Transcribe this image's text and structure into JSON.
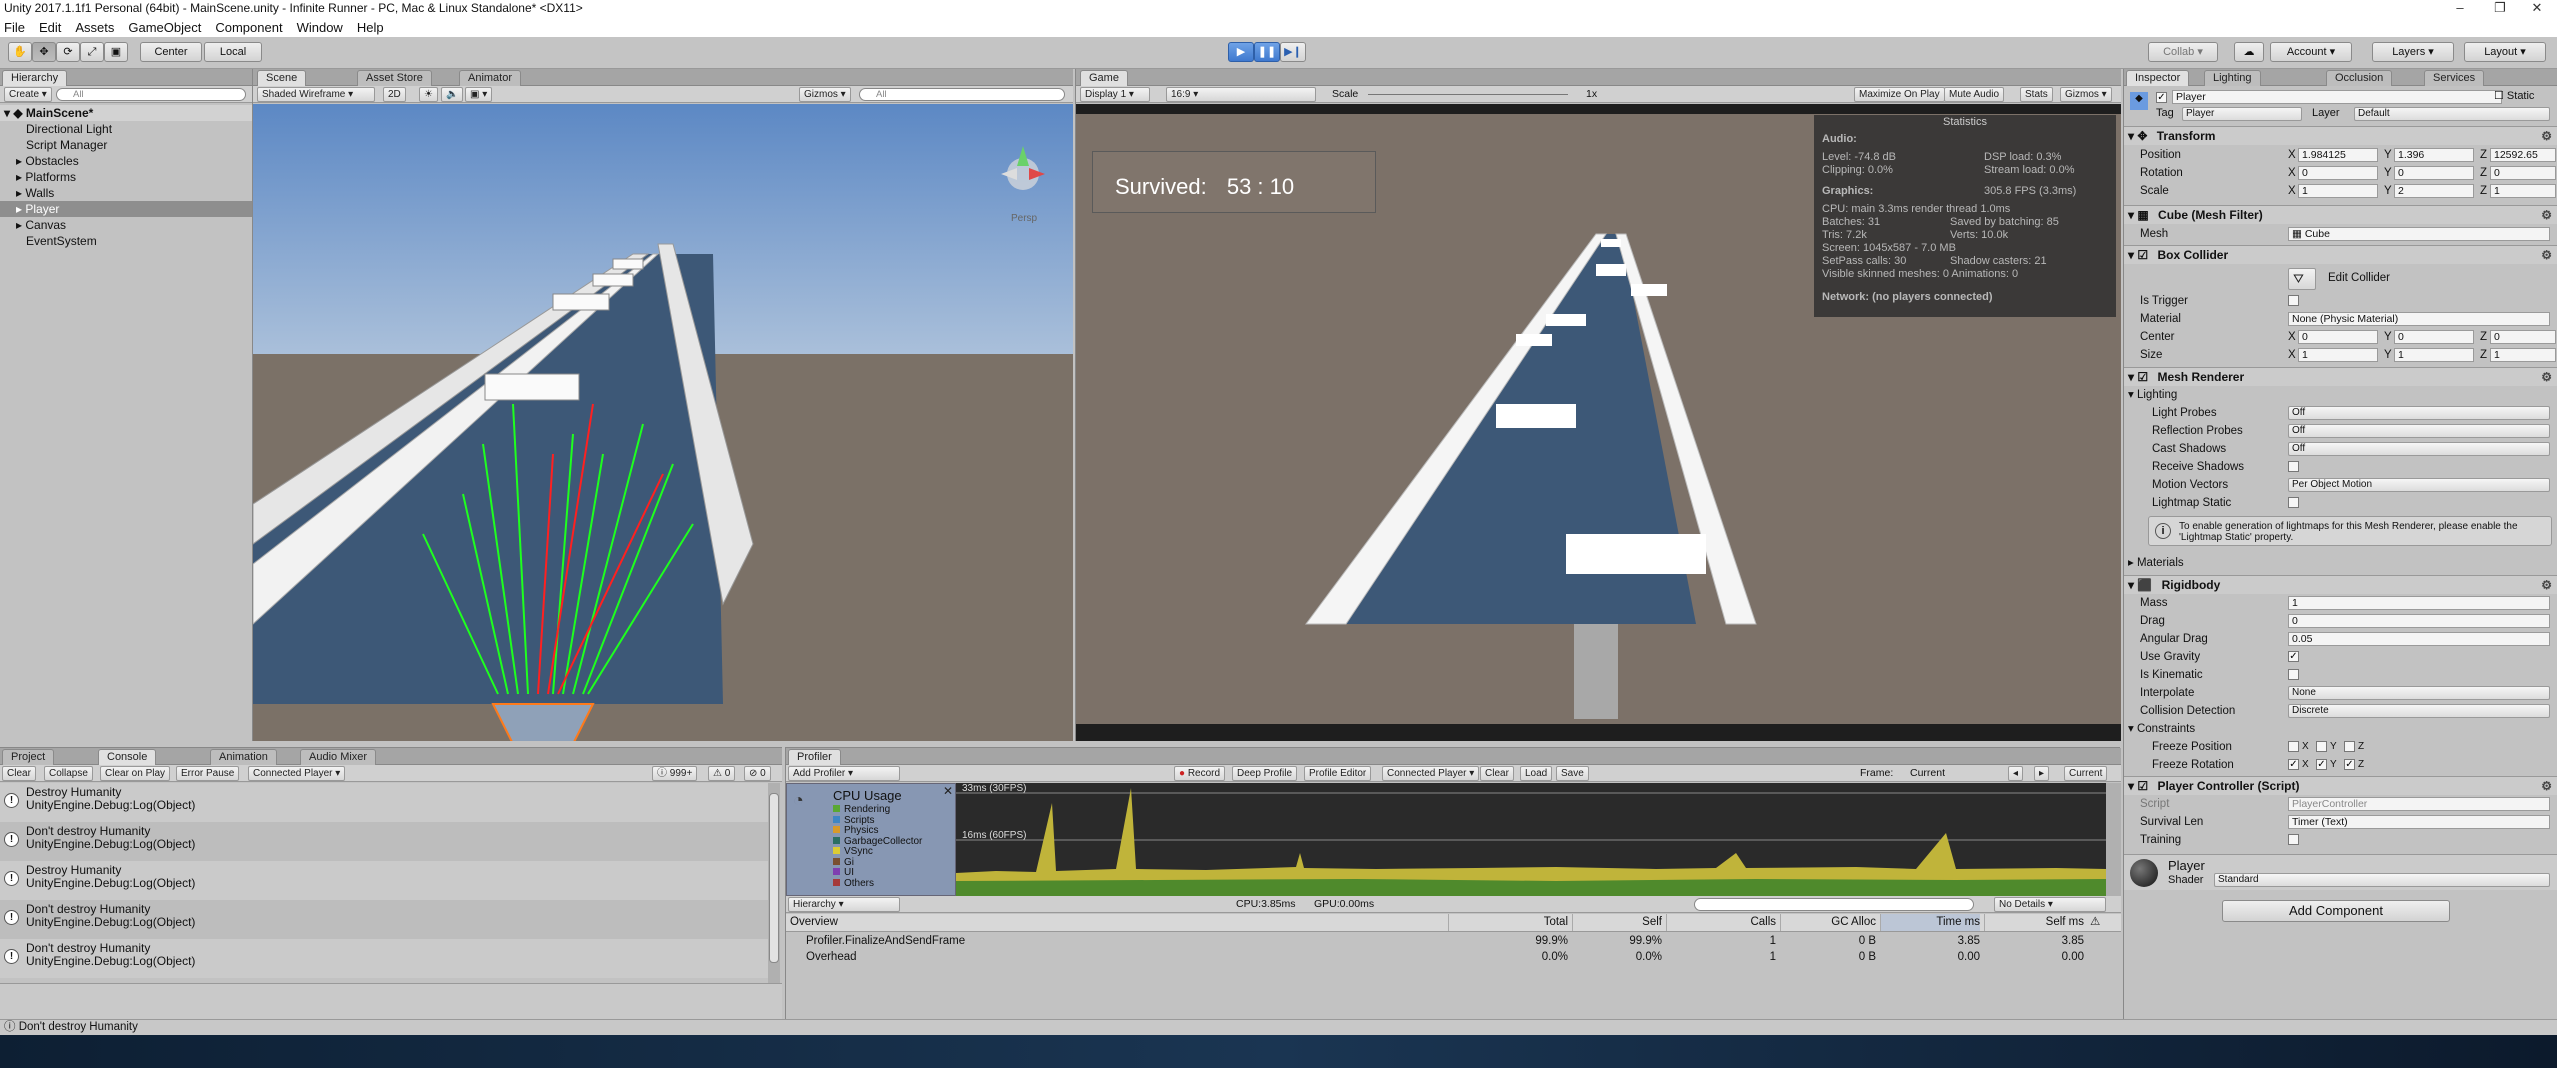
{
  "window": {
    "title": "Unity 2017.1.1f1 Personal (64bit) - MainScene.unity - Infinite Runner - PC, Mac & Linux Standalone* <DX11>"
  },
  "menu": [
    "File",
    "Edit",
    "Assets",
    "GameObject",
    "Component",
    "Window",
    "Help"
  ],
  "toolbar": {
    "center": "Center",
    "local": "Local",
    "collab": "Collab",
    "account": "Account",
    "layers": "Layers",
    "layout": "Layout"
  },
  "hierarchy": {
    "tab": "Hierarchy",
    "create": "Create",
    "search": "All",
    "scene": "MainScene*",
    "items": [
      "Directional Light",
      "Script Manager",
      "Obstacles",
      "Platforms",
      "Walls",
      "Player",
      "Canvas",
      "EventSystem"
    ]
  },
  "scene": {
    "tabs": [
      "Scene",
      "Asset Store",
      "Animator"
    ],
    "shading": "Shaded Wireframe",
    "mode2d": "2D",
    "gizmos": "Gizmos",
    "search": "All",
    "persp": "Persp"
  },
  "game": {
    "tab": "Game",
    "display": "Display 1",
    "aspect": "16:9",
    "scale_label": "Scale",
    "scale_value": "1x",
    "maximize": "Maximize On Play",
    "mute": "Mute Audio",
    "stats": "Stats",
    "gizmos": "Gizmos",
    "survived_label": "Survived:",
    "survived_value": "53 : 10"
  },
  "statistics": {
    "title": "Statistics",
    "audio_h": "Audio:",
    "level": "Level: -74.8 dB",
    "clipping": "Clipping: 0.0%",
    "dsp": "DSP load: 0.3%",
    "stream": "Stream load: 0.0%",
    "graphics_h": "Graphics:",
    "fps": "305.8 FPS (3.3ms)",
    "cpu": "CPU: main 3.3ms  render thread 1.0ms",
    "batches": "Batches: 31",
    "saved": "Saved by batching: 85",
    "tris": "Tris: 7.2k",
    "verts": "Verts: 10.0k",
    "screen": "Screen: 1045x587 - 7.0 MB",
    "setpass": "SetPass calls: 30",
    "shadow": "Shadow casters: 21",
    "skinned": "Visible skinned meshes: 0   Animations: 0",
    "network": "Network: (no players connected)"
  },
  "inspector": {
    "tabs": [
      "Inspector",
      "Lighting",
      "Occlusion",
      "Services"
    ],
    "name": "Player",
    "static": "Static",
    "tag_label": "Tag",
    "tag": "Player",
    "layer_label": "Layer",
    "layer": "Default",
    "transform": {
      "title": "Transform",
      "rows": [
        {
          "label": "Position",
          "x": "1.984125",
          "y": "1.396",
          "z": "12592.65"
        },
        {
          "label": "Rotation",
          "x": "0",
          "y": "0",
          "z": "0"
        },
        {
          "label": "Scale",
          "x": "1",
          "y": "2",
          "z": "1"
        }
      ]
    },
    "meshfilter": {
      "title": "Cube (Mesh Filter)",
      "mesh_label": "Mesh",
      "mesh": "Cube"
    },
    "boxcollider": {
      "title": "Box Collider",
      "edit": "Edit Collider",
      "is_trigger": "Is Trigger",
      "material_label": "Material",
      "material": "None (Physic Material)",
      "center_label": "Center",
      "cx": "0",
      "cy": "0",
      "cz": "0",
      "size_label": "Size",
      "sx": "1",
      "sy": "1",
      "sz": "1"
    },
    "meshrenderer": {
      "title": "Mesh Renderer",
      "lighting": "Lighting",
      "rows": [
        {
          "label": "Light Probes",
          "value": "Off"
        },
        {
          "label": "Reflection Probes",
          "value": "Off"
        },
        {
          "label": "Cast Shadows",
          "value": "Off"
        }
      ],
      "receive": "Receive Shadows",
      "motion_label": "Motion Vectors",
      "motion": "Per Object Motion",
      "lightmap": "Lightmap Static",
      "info": "To enable generation of lightmaps for this Mesh Renderer, please enable the 'Lightmap Static' property.",
      "materials": "Materials"
    },
    "rigidbody": {
      "title": "Rigidbody",
      "mass_label": "Mass",
      "mass": "1",
      "drag_label": "Drag",
      "drag": "0",
      "adrag_label": "Angular Drag",
      "adrag": "0.05",
      "gravity": "Use Gravity",
      "kinematic": "Is Kinematic",
      "interp_label": "Interpolate",
      "interp": "None",
      "coll_label": "Collision Detection",
      "coll": "Discrete",
      "constraints": "Constraints",
      "fpos": "Freeze Position",
      "frot": "Freeze Rotation",
      "x": "X",
      "y": "Y",
      "z": "Z"
    },
    "playercontroller": {
      "title": "Player Controller (Script)",
      "script_label": "Script",
      "script": "PlayerController",
      "surv_label": "Survival Len",
      "surv": "Timer (Text)",
      "training": "Training"
    },
    "material": {
      "name": "Player",
      "shader_label": "Shader",
      "shader": "Standard"
    },
    "add_component": "Add Component"
  },
  "console": {
    "tabs": [
      "Project",
      "Console",
      "Animation",
      "Audio Mixer"
    ],
    "buttons": [
      "Clear",
      "Collapse",
      "Clear on Play",
      "Error Pause",
      "Connected Player"
    ],
    "count_log": "999+",
    "count_warn": "0",
    "count_err": "0",
    "entries": [
      {
        "line1": "Destroy Humanity",
        "line2": "UnityEngine.Debug:Log(Object)"
      },
      {
        "line1": "Don't destroy Humanity",
        "line2": "UnityEngine.Debug:Log(Object)"
      },
      {
        "line1": "Destroy Humanity",
        "line2": "UnityEngine.Debug:Log(Object)"
      },
      {
        "line1": "Don't destroy Humanity",
        "line2": "UnityEngine.Debug:Log(Object)"
      },
      {
        "line1": "Don't destroy Humanity",
        "line2": "UnityEngine.Debug:Log(Object)"
      }
    ],
    "status": "Don't destroy Humanity"
  },
  "profiler": {
    "tab": "Profiler",
    "add": "Add Profiler",
    "buttons": [
      "Record",
      "Deep Profile",
      "Profile Editor",
      "Connected Player",
      "Clear",
      "Load",
      "Save"
    ],
    "frame_label": "Frame:",
    "frame": "Current",
    "current": "Current",
    "cpu_title": "CPU Usage",
    "legend": [
      {
        "name": "Rendering",
        "color": "#5aa832"
      },
      {
        "name": "Scripts",
        "color": "#3e86c4"
      },
      {
        "name": "Physics",
        "color": "#d89a2a"
      },
      {
        "name": "GarbageCollector",
        "color": "#2b6f63"
      },
      {
        "name": "VSync",
        "color": "#dccc35"
      },
      {
        "name": "Gi",
        "color": "#7a5030"
      },
      {
        "name": "UI",
        "color": "#7f3fb0"
      },
      {
        "name": "Others",
        "color": "#a63a3a"
      }
    ],
    "line30": "33ms (30FPS)",
    "line60": "16ms (60FPS)",
    "mode": "Hierarchy",
    "cpu_time": "CPU:3.85ms",
    "gpu_time": "GPU:0.00ms",
    "details": "No Details",
    "headers": [
      "Overview",
      "Total",
      "Self",
      "Calls",
      "GC Alloc",
      "Time ms",
      "Self ms"
    ],
    "rows": [
      {
        "name": "Profiler.FinalizeAndSendFrame",
        "total": "99.9%",
        "self": "99.9%",
        "calls": "1",
        "gc": "0 B",
        "time": "3.85",
        "selfms": "3.85"
      },
      {
        "name": "Overhead",
        "total": "0.0%",
        "self": "0.0%",
        "calls": "1",
        "gc": "0 B",
        "time": "0.00",
        "selfms": "0.00"
      }
    ]
  }
}
